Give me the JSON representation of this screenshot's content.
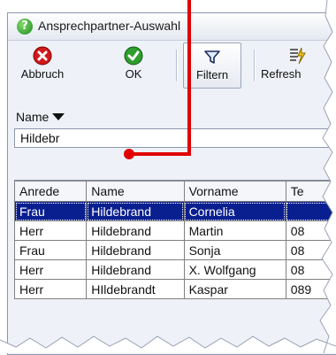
{
  "window": {
    "title": "Ansprechpartner-Auswahl"
  },
  "toolbar": {
    "abbruch_label": "Abbruch",
    "ok_label": "OK",
    "filtern_label": "Filtern",
    "refresh_label": "Refresh"
  },
  "filter": {
    "field_label": "Name",
    "value": "Hildebr"
  },
  "table": {
    "headers": [
      "Anrede",
      "Name",
      "Vorname",
      "Te"
    ],
    "rows": [
      [
        "Frau",
        "Hildebrand",
        "Cornelia",
        ""
      ],
      [
        "Herr",
        "Hildebrand",
        "Martin",
        "08"
      ],
      [
        "Frau",
        "Hildebrand",
        "Sonja",
        "08"
      ],
      [
        "Herr",
        "Hildebrand",
        "X. Wolfgang",
        "08"
      ],
      [
        "Herr",
        "HIldebrandt",
        "Kaspar",
        "089"
      ]
    ]
  },
  "colors": {
    "selection": "#0a1f8f",
    "annotation": "#e00000"
  }
}
